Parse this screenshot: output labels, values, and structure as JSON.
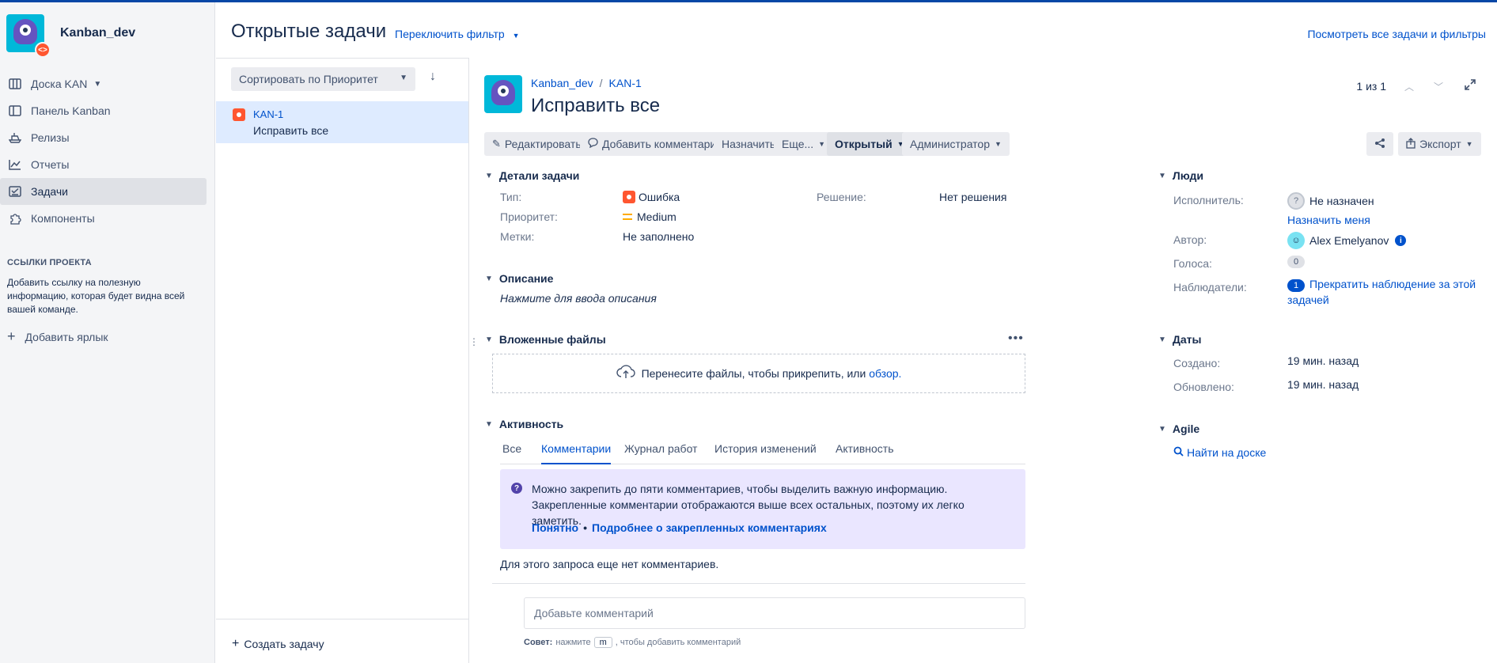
{
  "sidebar": {
    "project_name": "Kanban_dev",
    "nav": [
      {
        "label": "Доска KAN",
        "icon": "board-icon",
        "dropdown": true
      },
      {
        "label": "Панель Kanban",
        "icon": "kanban-icon"
      },
      {
        "label": "Релизы",
        "icon": "ship-icon"
      },
      {
        "label": "Отчеты",
        "icon": "chart-icon"
      },
      {
        "label": "Задачи",
        "icon": "issues-icon",
        "active": true
      },
      {
        "label": "Компоненты",
        "icon": "puzzle-icon"
      }
    ],
    "links_title": "ССЫЛКИ ПРОЕКТА",
    "links_text": "Добавить ссылку на полезную информацию, которая будет видна всей вашей команде.",
    "add_label": "Добавить ярлык"
  },
  "header": {
    "title": "Открытые задачи",
    "filter_switch": "Переключить фильтр",
    "view_all": "Посмотреть все задачи и фильтры"
  },
  "list": {
    "sort_label": "Сортировать по Приоритет",
    "items": [
      {
        "key": "KAN-1",
        "summary": "Исправить все"
      }
    ],
    "create_label": "Создать задачу"
  },
  "issue": {
    "breadcrumb_project": "Kanban_dev",
    "breadcrumb_key": "KAN-1",
    "title": "Исправить все",
    "pager": "1 из 1",
    "toolbar": {
      "edit": "Редактировать",
      "comment": "Добавить комментарий",
      "assign": "Назначить",
      "more": "Еще...",
      "status": "Открытый",
      "admin": "Администратор",
      "export": "Экспорт"
    },
    "details": {
      "heading": "Детали задачи",
      "type_label": "Тип:",
      "type_value": "Ошибка",
      "priority_label": "Приоритет:",
      "priority_value": "Medium",
      "labels_label": "Метки:",
      "labels_value": "Не заполнено",
      "resolution_label": "Решение:",
      "resolution_value": "Нет решения"
    },
    "description": {
      "heading": "Описание",
      "placeholder": "Нажмите для ввода описания"
    },
    "attachments": {
      "heading": "Вложенные файлы",
      "drop_text": "Перенесите файлы, чтобы прикрепить, или",
      "browse": "обзор."
    },
    "activity": {
      "heading": "Активность",
      "tabs": [
        "Все",
        "Комментарии",
        "Журнал работ",
        "История изменений",
        "Активность"
      ],
      "active_tab": "Комментарии",
      "pin_text": "Можно закрепить до пяти комментариев, чтобы выделить важную информацию. Закрепленные комментарии отображаются выше всех остальных, поэтому их легко заметить.",
      "pin_ok": "Понятно",
      "pin_more": "Подробнее о закрепленных комментариях",
      "no_comments": "Для этого запроса еще нет комментариев.",
      "comment_placeholder": "Добавьте комментарий",
      "tip_label": "Совет:",
      "tip_pre": "нажмите",
      "tip_key": "m",
      "tip_post": ", чтобы добавить комментарий"
    }
  },
  "people": {
    "heading": "Люди",
    "assignee_label": "Исполнитель:",
    "assignee_value": "Не назначен",
    "assign_me": "Назначить меня",
    "reporter_label": "Автор:",
    "reporter_value": "Alex Emelyanov",
    "votes_label": "Голоса:",
    "votes_value": "0",
    "watchers_label": "Наблюдатели:",
    "watchers_count": "1",
    "watchers_action": "Прекратить наблюдение за этой задачей"
  },
  "dates": {
    "heading": "Даты",
    "created_label": "Создано:",
    "created_value": "19 мин. назад",
    "updated_label": "Обновлено:",
    "updated_value": "19 мин. назад"
  },
  "agile": {
    "heading": "Agile",
    "find_on_board": "Найти на доске"
  },
  "colors": {
    "accent": "#0052cc",
    "bug": "#ff5630",
    "priority_medium": "#ffab00",
    "pin_bg": "#eae6ff"
  }
}
